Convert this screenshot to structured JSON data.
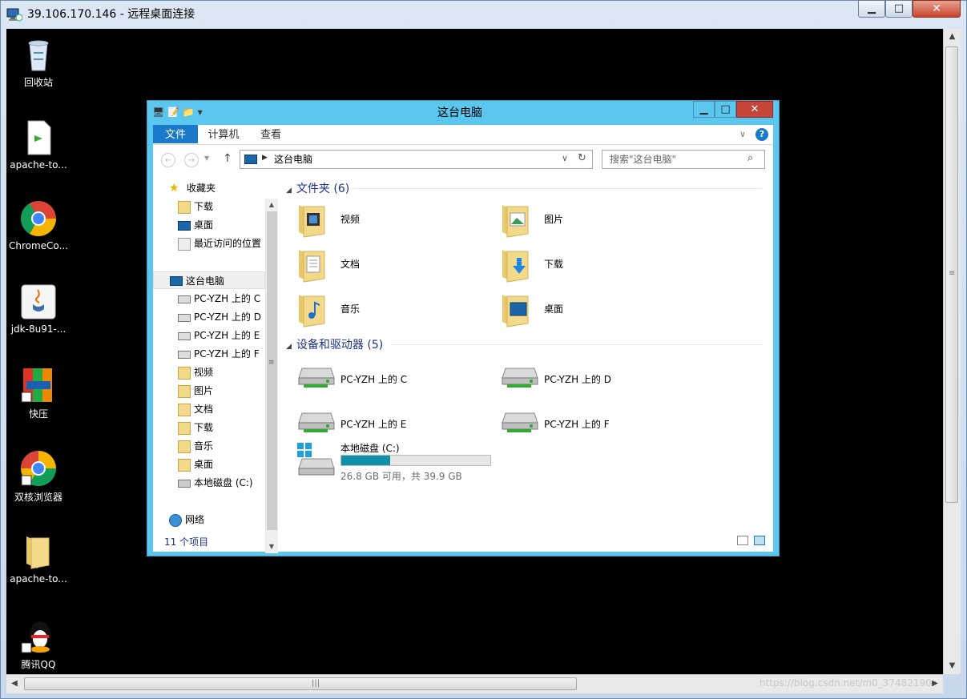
{
  "rdp": {
    "title": "39.106.170.146 - 远程桌面连接",
    "watermark": "https://blog.csdn.net/m0_37482190"
  },
  "desktop_icons": [
    {
      "label": "回收站",
      "icon": "recycle-bin-icon"
    },
    {
      "label": "apache-to...",
      "icon": "document-icon"
    },
    {
      "label": "ChromeCo...",
      "icon": "chrome-icon"
    },
    {
      "label": "jdk-8u91-...",
      "icon": "java-icon"
    },
    {
      "label": "快压",
      "icon": "archive-icon"
    },
    {
      "label": "双核浏览器",
      "icon": "browser-icon"
    },
    {
      "label": "apache-to...",
      "icon": "folder-icon"
    },
    {
      "label": "腾讯QQ",
      "icon": "qq-icon"
    }
  ],
  "explorer": {
    "title": "这台电脑",
    "ribbon_tabs": [
      "文件",
      "计算机",
      "查看"
    ],
    "address": "这台电脑",
    "search_placeholder": "搜索\"这台电脑\"",
    "nav": {
      "favorites": "收藏夹",
      "fav_items": [
        "下载",
        "桌面",
        "最近访问的位置"
      ],
      "thispc": "这台电脑",
      "pc_items": [
        "PC-YZH 上的 C",
        "PC-YZH 上的 D",
        "PC-YZH 上的 E",
        "PC-YZH 上的 F",
        "视频",
        "图片",
        "文档",
        "下载",
        "音乐",
        "桌面",
        "本地磁盘 (C:)"
      ],
      "network": "网络"
    },
    "folders_group": "文件夹 (6)",
    "folders": [
      "视频",
      "图片",
      "文档",
      "下载",
      "音乐",
      "桌面"
    ],
    "devices_group": "设备和驱动器 (5)",
    "drives": [
      "PC-YZH 上的 C",
      "PC-YZH 上的 D",
      "PC-YZH 上的 E",
      "PC-YZH 上的 F"
    ],
    "local_disk": {
      "name": "本地磁盘 (C:)",
      "free_text": "26.8 GB 可用，共 39.9 GB",
      "used_fraction": 0.33,
      "bar_color": "#0f8fa8"
    },
    "status": "11 个项目"
  },
  "colors": {
    "accent": "#1979ca",
    "window_frame": "#5bc6ee",
    "close_red": "#c7463a"
  }
}
